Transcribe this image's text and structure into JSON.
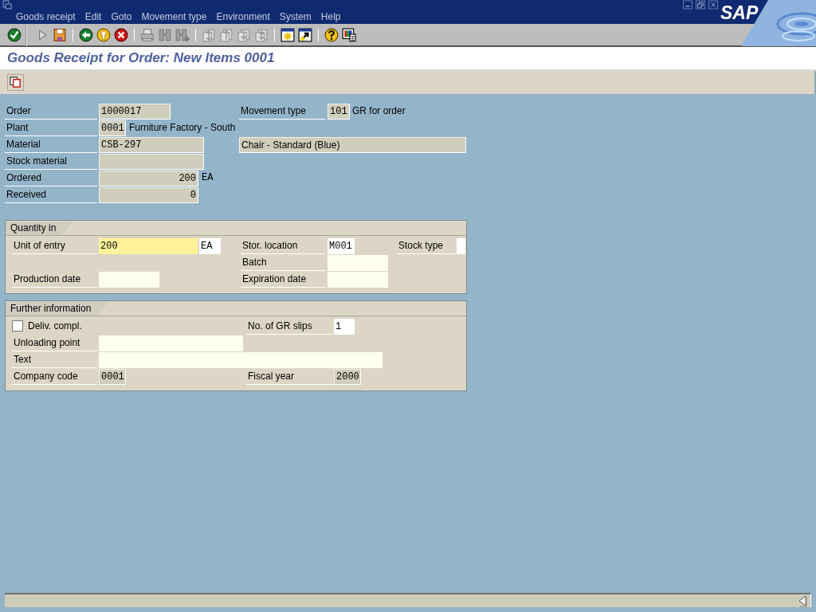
{
  "menu": [
    "Goods receipt",
    "Edit",
    "Goto",
    "Movement type",
    "Environment",
    "System",
    "Help"
  ],
  "toolbar": [
    {
      "kind": "enter",
      "disabled": false
    },
    {
      "kind": "execute",
      "disabled": false
    },
    {
      "kind": "save",
      "disabled": false
    },
    {
      "kind": "back",
      "disabled": false
    },
    {
      "kind": "exit",
      "disabled": false
    },
    {
      "kind": "cancel",
      "disabled": false
    },
    {
      "kind": "print",
      "disabled": true
    },
    {
      "kind": "find",
      "disabled": true
    },
    {
      "kind": "find-next",
      "disabled": true
    },
    {
      "kind": "first-page",
      "disabled": true
    },
    {
      "kind": "previous-page",
      "disabled": true
    },
    {
      "kind": "next-page",
      "disabled": true
    },
    {
      "kind": "last-page",
      "disabled": true
    },
    {
      "kind": "new-session",
      "disabled": false
    },
    {
      "kind": "shortcut",
      "disabled": false
    },
    {
      "kind": "help",
      "disabled": false
    },
    {
      "kind": "layout",
      "disabled": false
    }
  ],
  "logo": "SAP",
  "title": "Goods Receipt for Order: New Items 0001",
  "header": {
    "order": {
      "label": "Order",
      "value": "1000017"
    },
    "plant": {
      "label": "Plant",
      "value": "0001",
      "description": "Furniture Factory - South"
    },
    "material": {
      "label": "Material",
      "value": "CSB-297",
      "description": "Chair - Standard (Blue)"
    },
    "stock_material": {
      "label": "Stock material"
    },
    "ordered": {
      "label": "Ordered",
      "value": "200",
      "unit": "EA"
    },
    "received": {
      "label": "Received",
      "value": "0"
    },
    "movement_type": {
      "label": "Movement type",
      "value": "101",
      "description": "GR for order"
    }
  },
  "quantity_in": {
    "title": "Quantity in",
    "unit_of_entry": {
      "label": "Unit of entry",
      "value": "200",
      "unit": "EA",
      "focused": true
    },
    "stor_location": {
      "label": "Stor. location",
      "value": "M001"
    },
    "stock_type": {
      "label": "Stock type"
    },
    "batch": {
      "label": "Batch"
    },
    "production_date": {
      "label": "Production date"
    },
    "expiration_date": {
      "label": "Expiration date"
    }
  },
  "further_information": {
    "title": "Further information",
    "deliv_compl": {
      "label": "Deliv. compl.",
      "checked": false
    },
    "gr_slips": {
      "label": "No. of GR slips",
      "value": "1"
    },
    "unloading_point": {
      "label": "Unloading point"
    },
    "text": {
      "label": "Text"
    },
    "company_code": {
      "label": "Company code",
      "value": "0001"
    },
    "fiscal_year": {
      "label": "Fiscal year",
      "value": "2000"
    }
  }
}
